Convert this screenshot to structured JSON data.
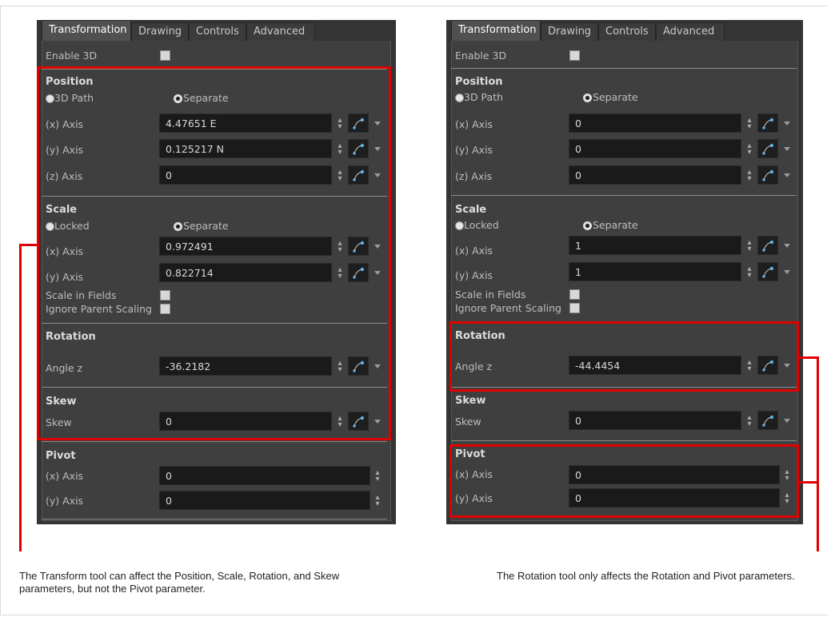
{
  "tabs": [
    "Transformation",
    "Drawing",
    "Controls",
    "Advanced"
  ],
  "labels": {
    "enable_3d": "Enable 3D",
    "position": "Position",
    "path_3d": "3D Path",
    "separate": "Separate",
    "x_axis": "(x) Axis",
    "y_axis": "(y) Axis",
    "z_axis": "(z) Axis",
    "scale": "Scale",
    "locked": "Locked",
    "scale_in_fields": "Scale in Fields",
    "ignore_parent_scaling": "Ignore Parent Scaling",
    "rotation": "Rotation",
    "angle_z": "Angle z",
    "skew_header": "Skew",
    "skew": "Skew",
    "pivot": "Pivot"
  },
  "left_panel": {
    "position": {
      "x": "4.47651 E",
      "y": "0.125217 N",
      "z": "0"
    },
    "scale": {
      "x": "0.972491",
      "y": "0.822714"
    },
    "rotation": {
      "angle_z": "-36.2182"
    },
    "skew": "0",
    "pivot": {
      "x": "0",
      "y": "0"
    },
    "caption": "The Transform tool can affect the Position, Scale, Rotation, and Skew parameters, but not the Pivot parameter."
  },
  "right_panel": {
    "position": {
      "x": "0",
      "y": "0",
      "z": "0"
    },
    "scale": {
      "x": "1",
      "y": "1"
    },
    "rotation": {
      "angle_z": "-44.4454"
    },
    "skew": "0",
    "pivot": {
      "x": "0",
      "y": "0"
    },
    "caption": "The Rotation tool only affects the Rotation and Pivot parameters."
  },
  "colors": {
    "highlight": "#e00000",
    "panel_bg": "#3f3f3f",
    "field_bg": "#1a1a1a"
  },
  "icons": [
    "function-curve-icon",
    "spinner-arrows-icon",
    "dropdown-arrow-icon"
  ]
}
